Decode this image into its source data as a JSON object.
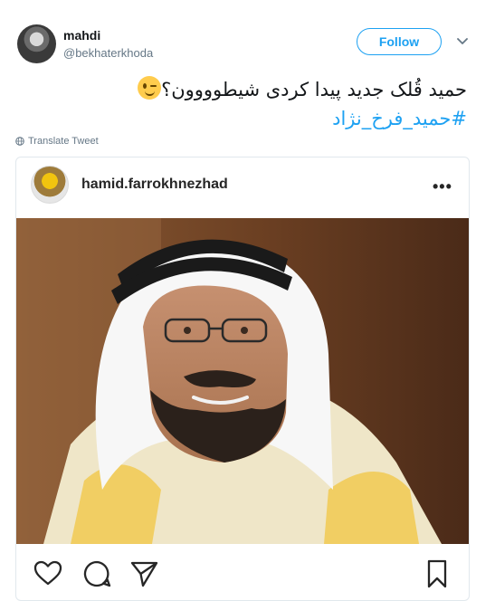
{
  "tweet": {
    "user_name": "mahdi",
    "user_handle": "@bekhaterkhoda",
    "follow_label": "Follow",
    "text_line": "حمید قُلک جدید پیدا کردی شیطوووون؟",
    "hashtag": "#حمید_فرخ_نژاد",
    "translate_label": "Translate Tweet"
  },
  "embed": {
    "username": "hamid.farrokhnezhad",
    "more_label": "•••"
  },
  "icons": {
    "caret": "chevron-down-icon",
    "globe": "globe-icon",
    "like": "heart-icon",
    "comment": "comment-icon",
    "share": "send-icon",
    "save": "bookmark-icon"
  },
  "colors": {
    "accent": "#1da1f2",
    "text": "#14171a",
    "muted": "#657786",
    "border": "#e1e8ed"
  }
}
